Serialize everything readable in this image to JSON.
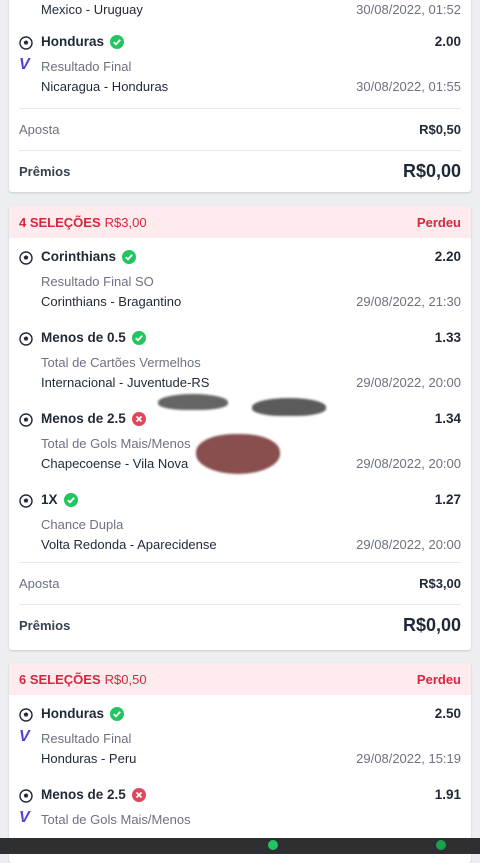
{
  "card1": {
    "partial_teams": "Mexico - Uruguay",
    "partial_date": "30/08/2022, 01:52",
    "selection": {
      "name": "Honduras",
      "odd": "2.00",
      "market": "Resultado Final",
      "teams": "Nicaragua - Honduras",
      "date": "30/08/2022, 01:55"
    },
    "stake_label": "Aposta",
    "stake_value": "R$0,50",
    "prize_label": "Prêmios",
    "prize_value": "R$0,00"
  },
  "card2": {
    "count": "4 SELEÇÕES",
    "amount": "R$3,00",
    "status": "Perdeu",
    "selections": [
      {
        "name": "Corinthians",
        "odd": "2.20",
        "market": "Resultado Final SO",
        "teams": "Corinthians - Bragantino",
        "date": "29/08/2022, 21:30",
        "result": "won"
      },
      {
        "name": "Menos de 0.5",
        "odd": "1.33",
        "market": "Total de Cartões Vermelhos",
        "teams": "Internacional - Juventude-RS",
        "date": "29/08/2022, 20:00",
        "result": "won"
      },
      {
        "name": "Menos de 2.5",
        "odd": "1.34",
        "market": "Total de Gols Mais/Menos",
        "teams": "Chapecoense - Vila Nova",
        "date": "29/08/2022, 20:00",
        "result": "lost"
      },
      {
        "name": "1X",
        "odd": "1.27",
        "market": "Chance Dupla",
        "teams": "Volta Redonda - Aparecidense",
        "date": "29/08/2022, 20:00",
        "result": "won"
      }
    ],
    "stake_label": "Aposta",
    "stake_value": "R$3,00",
    "prize_label": "Prêmios",
    "prize_value": "R$0,00"
  },
  "card3": {
    "count": "6 SELEÇÕES",
    "amount": "R$0,50",
    "status": "Perdeu",
    "selections": [
      {
        "name": "Honduras",
        "odd": "2.50",
        "market": "Resultado Final",
        "teams": "Honduras - Peru",
        "date": "29/08/2022, 15:19",
        "result": "won"
      },
      {
        "name": "Menos de 2.5",
        "odd": "1.91",
        "market": "Total de Gols Mais/Menos",
        "teams": "",
        "date": "",
        "result": "lost"
      }
    ]
  },
  "icons": {
    "sport": "soccer-ball-icon",
    "won": "check-circle-icon",
    "lost": "x-circle-icon",
    "provider": "v-logo-icon"
  },
  "colors": {
    "loss_red": "#d7263d",
    "win_green": "#22c55e",
    "header_bg": "#fdebee",
    "provider_purple": "#5b3fd6"
  }
}
